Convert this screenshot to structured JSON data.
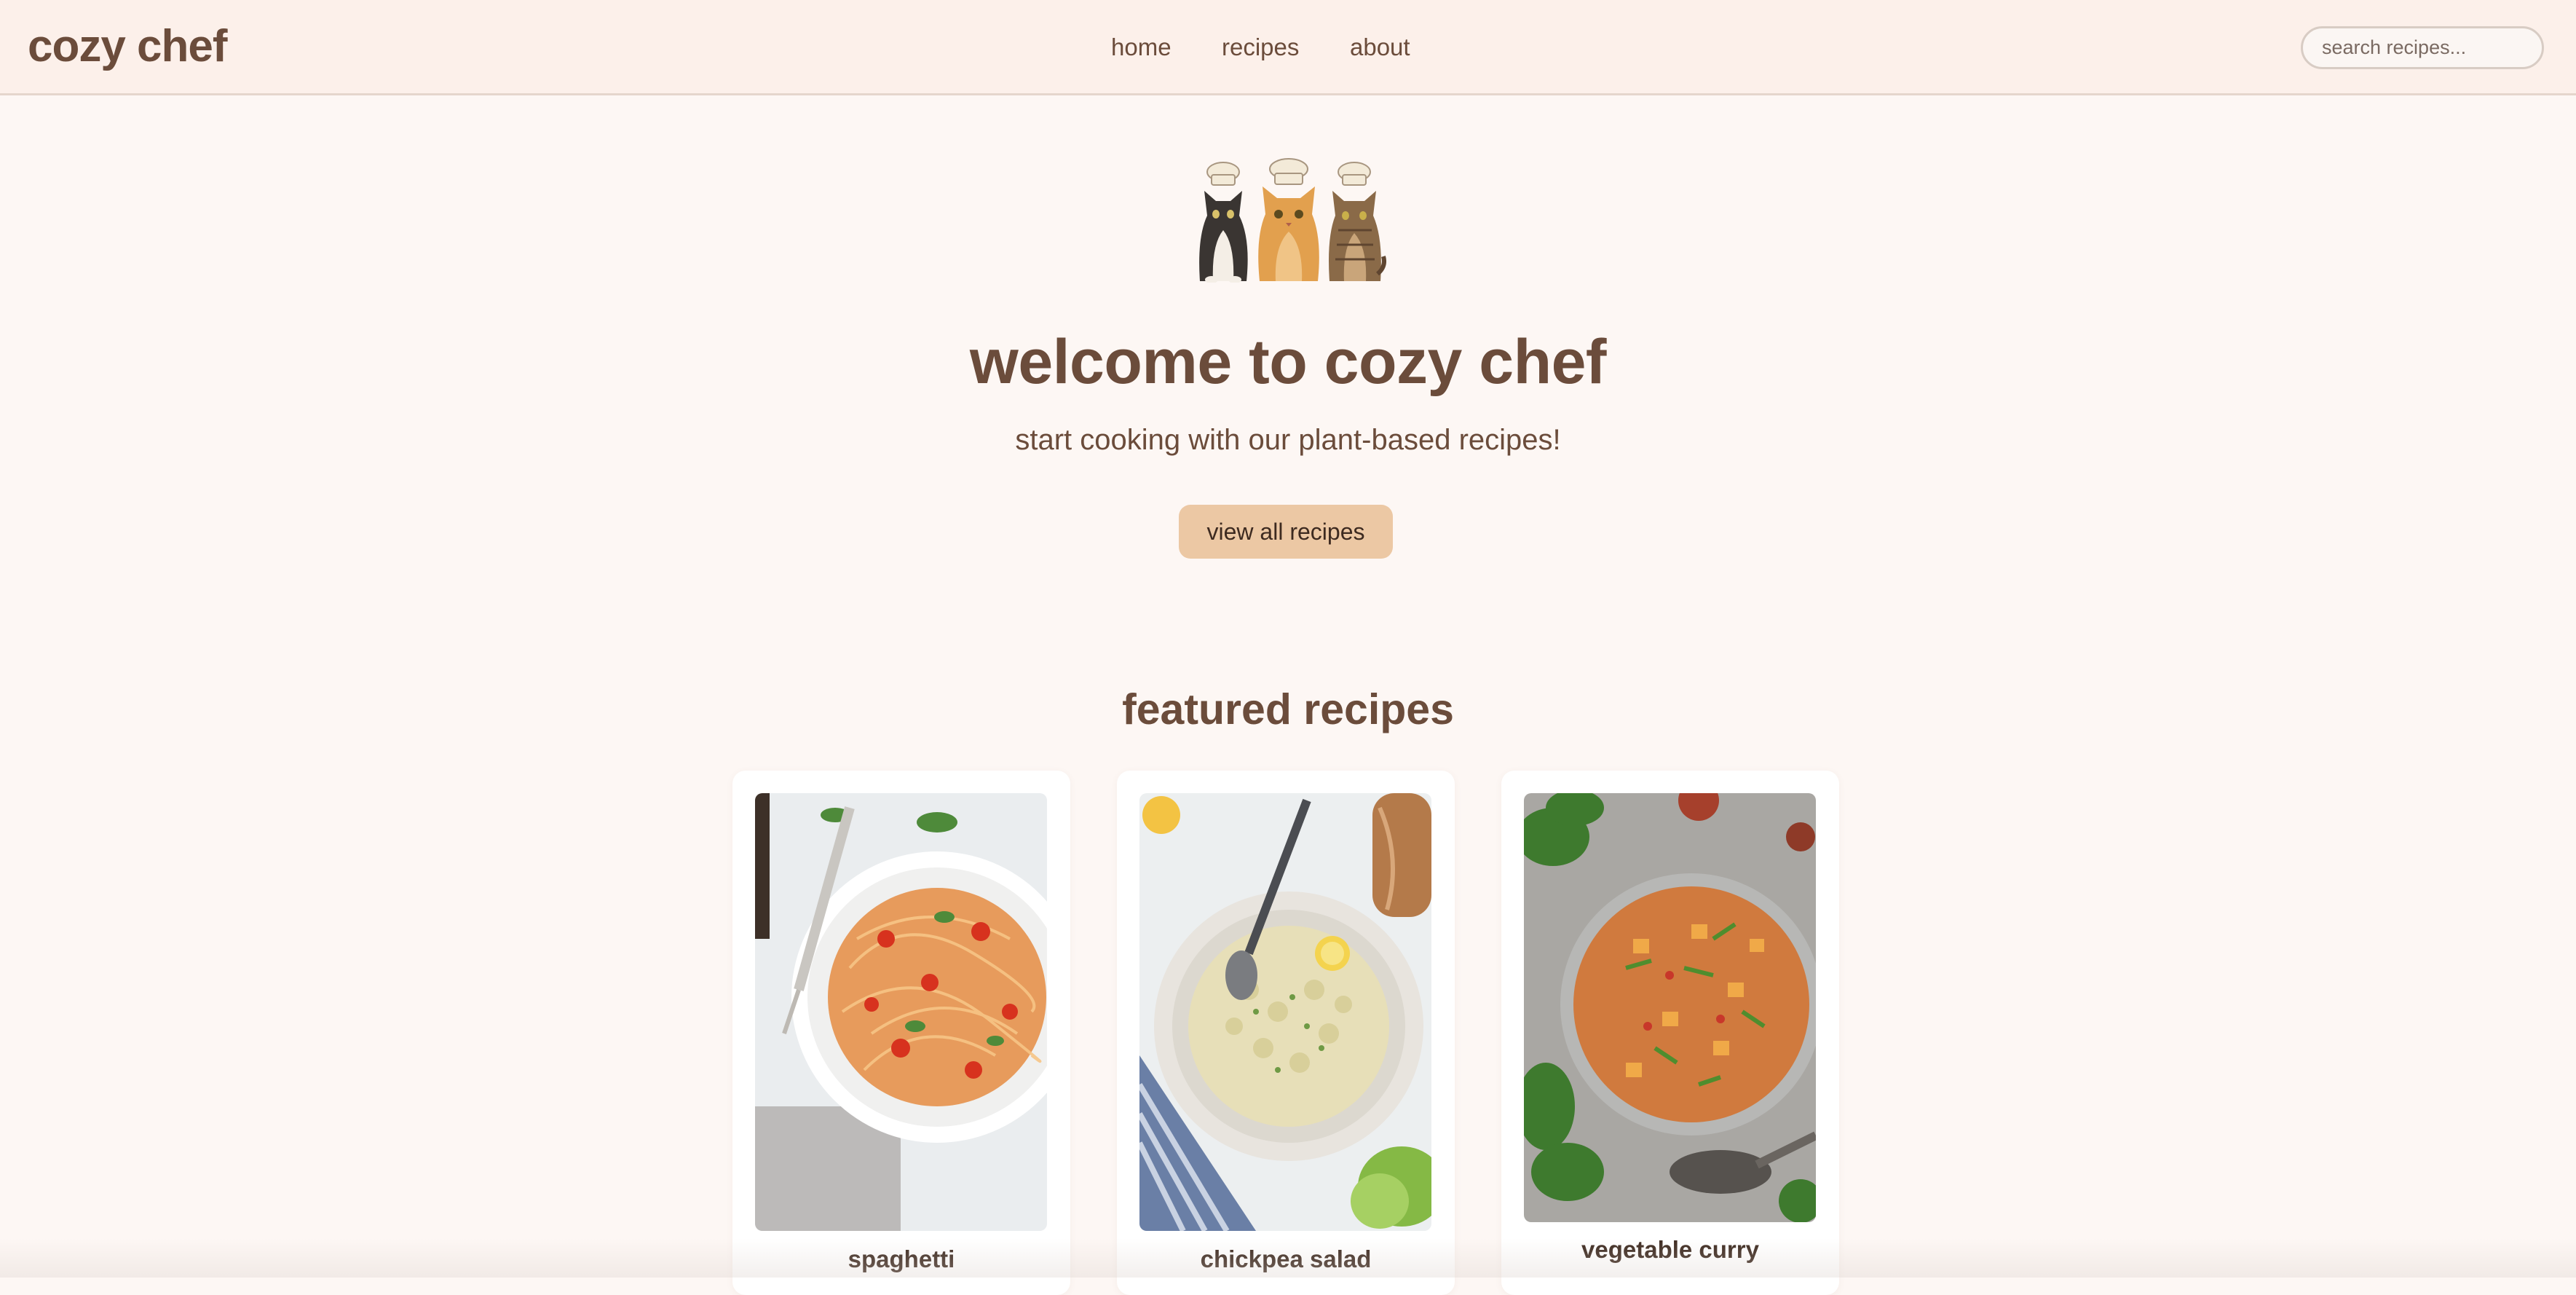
{
  "header": {
    "logo": "cozy chef",
    "nav": [
      {
        "label": "home"
      },
      {
        "label": "recipes"
      },
      {
        "label": "about"
      }
    ],
    "search_placeholder": "search recipes..."
  },
  "hero": {
    "image_icon": "chef-cats-illustration",
    "title": "welcome to cozy chef",
    "subtitle": "start cooking with our plant-based recipes!",
    "button_label": "view all recipes"
  },
  "featured": {
    "title": "featured recipes",
    "recipes": [
      {
        "name": "spaghetti",
        "image_icon": "spaghetti-photo"
      },
      {
        "name": "chickpea salad",
        "image_icon": "chickpea-salad-photo"
      },
      {
        "name": "vegetable curry",
        "image_icon": "vegetable-curry-photo"
      }
    ]
  },
  "colors": {
    "accent": "#ecc8a4",
    "text": "#6b4c3b",
    "header_bg": "#fcf0ea",
    "page_bg": "#fdf7f4"
  }
}
